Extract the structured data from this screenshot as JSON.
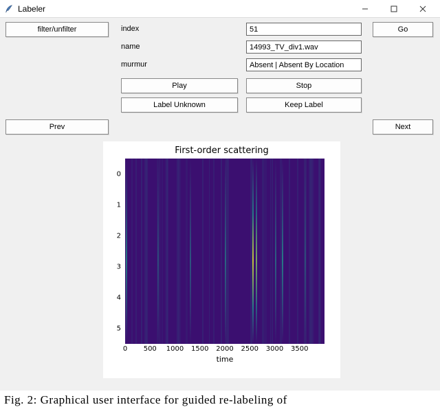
{
  "window": {
    "title": "Labeler"
  },
  "toolbar": {
    "filter_label": "filter/unfilter",
    "go_label": "Go"
  },
  "fields": {
    "index_label": "index",
    "index_value": "51",
    "name_label": "name",
    "name_value": "14993_TV_div1.wav",
    "murmur_label": "murmur",
    "murmur_value": "Absent | Absent By Location"
  },
  "controls": {
    "play": "Play",
    "stop": "Stop",
    "label_unknown": "Label Unknown",
    "keep_label": "Keep Label",
    "prev": "Prev",
    "next": "Next"
  },
  "chart": {
    "title": "First-order scattering",
    "xlabel": "time"
  },
  "caption": "Fig.  2:  Graphical  user  interface  for  guided  re-labeling  of",
  "chart_data": {
    "type": "heatmap",
    "title": "First-order scattering",
    "xlabel": "time",
    "ylabel": "",
    "x_ticks": [
      0,
      500,
      1000,
      1500,
      2000,
      2500,
      3000,
      3500
    ],
    "y_ticks": [
      0,
      1,
      2,
      3,
      4,
      5
    ],
    "xlim": [
      0,
      4000
    ],
    "ylim": [
      -0.5,
      5.5
    ],
    "colormap": "viridis",
    "note": "Vertical streaks of higher intensity around x≈0, 650, 1300, 2000, 2600, 3000–3200, 3600; brightest peak near x≈2600 for y≈2–4. Background is low intensity (dark violet).",
    "streaks": [
      {
        "x": 20,
        "width": 18,
        "intensity": 0.45
      },
      {
        "x": 650,
        "width": 12,
        "intensity": 0.35
      },
      {
        "x": 1300,
        "width": 10,
        "intensity": 0.3
      },
      {
        "x": 2000,
        "width": 14,
        "intensity": 0.4
      },
      {
        "x": 2550,
        "width": 22,
        "intensity": 0.9
      },
      {
        "x": 2620,
        "width": 10,
        "intensity": 0.7
      },
      {
        "x": 3000,
        "width": 10,
        "intensity": 0.35
      },
      {
        "x": 3150,
        "width": 14,
        "intensity": 0.45
      },
      {
        "x": 3600,
        "width": 10,
        "intensity": 0.3
      }
    ]
  }
}
